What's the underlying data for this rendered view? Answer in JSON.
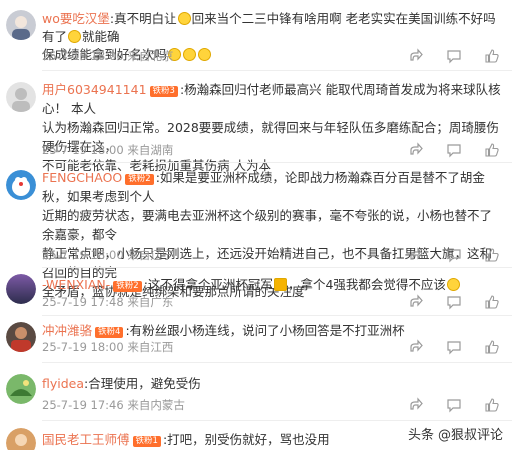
{
  "comments": [
    {
      "user": "wo要吃汉堡",
      "badge": "",
      "separator": ":",
      "text_lines": [
        "真不明白让",
        "回来当个二三中锋有啥用啊 老老实实在美国训练不好吗 有了",
        "就能确",
        "保成绩能拿到好名次吗"
      ],
      "emoji_count": 3,
      "time": "25-7-19 18:00 来自北京"
    },
    {
      "user": "用户6034941141",
      "badge": "铁粉3",
      "separator": ":",
      "text_lines": [
        "杨瀚森回归付老师最高兴 能取代周琦首发成为将来球队核心！ 本人",
        "认为杨瀚森回归正常。2028要要成绩，就得回来与年轻队伍多磨练配合；周琦腰伤硬伤摆在这，",
        "不可能老依靠、老耗损加重其伤病 人为本"
      ],
      "time": "25-7-19 18:00 来自湖南"
    },
    {
      "user": "FENGCHAOO",
      "badge": "铁粉2",
      "separator": ":",
      "text_lines": [
        "如果是要亚洲杯成绩，论即战力杨瀚森百分百是替不了胡金秋，如果考虑到个人",
        "近期的疲劳状态，要满电去亚洲杯这个级别的赛事，毫不夸张的说，小杨也替不了余嘉豪，都令",
        "静正常点吧，小杨只是刚选上，还远没开始精进自己，也不具备扛男篮大旗，这和召回的目的完",
        "全矛盾，篮协就是纯绑架和要那点所谓的关注度"
      ],
      "time": "25-7-19 18:00 来自辽宁"
    },
    {
      "user": "-WENXIAN-",
      "badge": "铁粉2",
      "separator": ":",
      "text_lines": [
        "这不得拿个亚洲杯冠军",
        "，拿个4强我都会觉得不应该"
      ],
      "time": "25-7-19 17:48 来自广东"
    },
    {
      "user": "冲冲潍骆",
      "badge": "铁粉4",
      "separator": ":",
      "text_lines": [
        "有粉丝跟小杨连线，说问了小杨回答是不打亚洲杯"
      ],
      "time": "25-7-19 18:00 来自江西"
    },
    {
      "user": "flyidea",
      "badge": "",
      "separator": ":",
      "text_lines": [
        "合理使用，避免受伤"
      ],
      "time": "25-7-19 17:46 来自内蒙古"
    },
    {
      "user": "国民老工王师傅",
      "badge": "铁粉1",
      "separator": ":",
      "text_lines": [
        "打吧，别受伤就好，骂也没用"
      ],
      "time": ""
    }
  ],
  "footer": {
    "platform": "头条",
    "account": "@狠叔评论"
  },
  "colors": {
    "username": "#eb7350",
    "meta": "#999999",
    "badge": "#ff6f2c"
  }
}
